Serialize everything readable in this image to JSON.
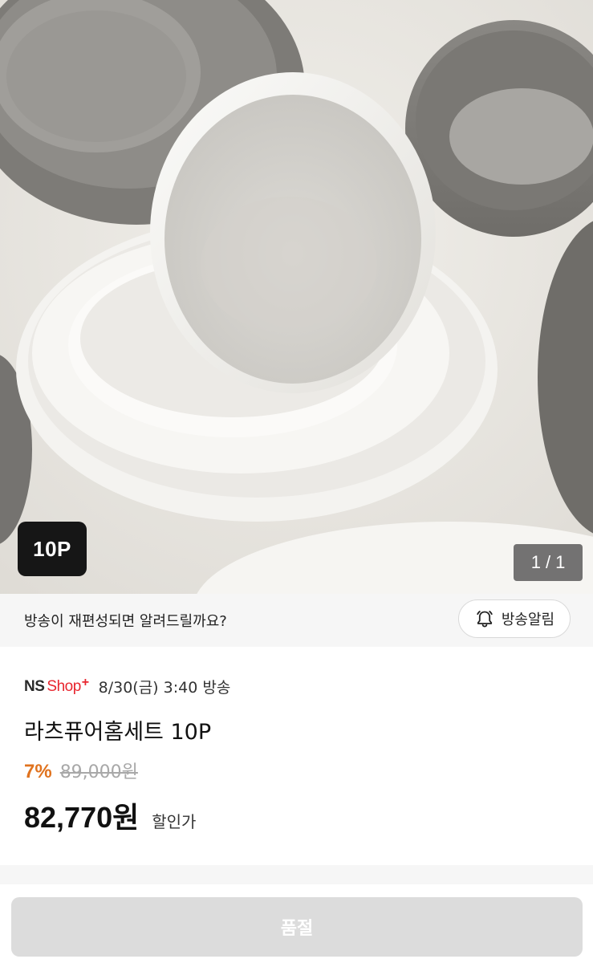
{
  "hero": {
    "badge": "10P",
    "counter": {
      "current": "1",
      "separator": "/",
      "total": "1"
    }
  },
  "notify": {
    "message": "방송이 재편성되면 알려드릴까요?",
    "button_label": "방송알림",
    "button_icon": "bell-icon"
  },
  "product": {
    "shop_logo": {
      "ns": "NS",
      "shop": "Shop",
      "plus": "+"
    },
    "broadcast_time": "8/30(금) 3:40 방송",
    "title": "라츠퓨어홈세트 10P",
    "discount_rate": "7%",
    "original_price": "89,000원",
    "sale_price": "82,770원",
    "sale_label": "할인가"
  },
  "footer": {
    "soldout_label": "품절"
  },
  "colors": {
    "discount": "#e0731f",
    "brand_red": "#e8262f",
    "soldout_bg": "#dcdcdc"
  }
}
